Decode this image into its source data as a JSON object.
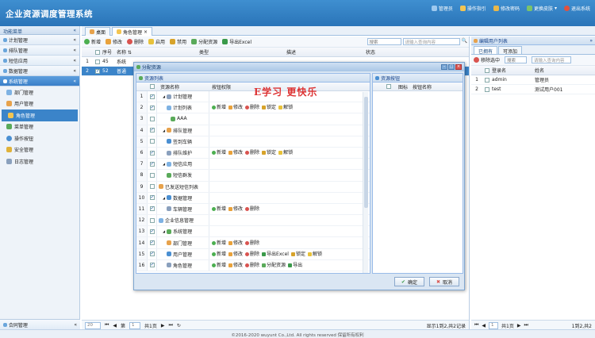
{
  "header": {
    "title": "企业资源调度管理系统",
    "links": [
      "管理员",
      "操作指引",
      "修改密码",
      "更换皮肤",
      "退出系统"
    ]
  },
  "sidebar": {
    "title": "功能菜单",
    "collapse": "«",
    "groups": [
      "计划管理",
      "排队管理",
      "短信应用",
      "数据管理",
      "系统管理"
    ],
    "items": [
      "部门管理",
      "用户管理",
      "角色管理",
      "菜单管理",
      "操作按钮",
      "安全管理",
      "日志管理"
    ],
    "footer": "合同管理"
  },
  "tabs": [
    "桌面",
    "角色管理"
  ],
  "toolbar": {
    "buttons": [
      "新增",
      "修改",
      "删除",
      "启用",
      "禁用",
      "分配资源",
      "导出Excel"
    ],
    "search_select": "搜索",
    "search_placeholder": "请输入查询内容"
  },
  "grid": {
    "columns": [
      "序号",
      "名称",
      "类型",
      "描述",
      "状态"
    ],
    "rows": [
      {
        "no": "1",
        "id": "45",
        "name": "系统"
      },
      {
        "no": "2",
        "id": "52",
        "name": "普通"
      }
    ]
  },
  "pager": {
    "page_size": "20",
    "page_label": "第",
    "page": "1",
    "total_pages": "共1页",
    "info": "显示1到2,共2记录"
  },
  "right": {
    "title": "编辑用户列表",
    "tabs": [
      "已拥有",
      "可添加"
    ],
    "remove": "移除选中",
    "search_select": "搜索",
    "search_placeholder": "请输入查询内容",
    "columns": [
      "登录名",
      "姓名"
    ],
    "rows": [
      {
        "no": "1",
        "login": "admin",
        "name": "管理员"
      },
      {
        "no": "2",
        "login": "test",
        "name": "测试用户001"
      }
    ],
    "pager_page": "1",
    "pager_total": "共1页",
    "pager_info": "1到2,共2"
  },
  "dialog": {
    "title": "分配资源",
    "watermark": "E学习  更快乐",
    "left_title": "资源列表",
    "left_cols": [
      "资源名称",
      "按钮权限"
    ],
    "right_title": "资源按钮",
    "right_cols": [
      "图标",
      "按钮名称"
    ],
    "ok": "确定",
    "cancel": "取消",
    "rows": [
      {
        "no": "1",
        "name": "计划管理",
        "indent": 1,
        "perms": []
      },
      {
        "no": "2",
        "name": "计划列表",
        "indent": 2,
        "perms": [
          "新增",
          "修改",
          "删除",
          "锁定",
          "解锁"
        ]
      },
      {
        "no": "3",
        "name": "AAA",
        "indent": 3,
        "perms": []
      },
      {
        "no": "4",
        "name": "排队管理",
        "indent": 1,
        "perms": []
      },
      {
        "no": "5",
        "name": "签到车辆",
        "indent": 2,
        "perms": []
      },
      {
        "no": "6",
        "name": "排队维护",
        "indent": 2,
        "perms": [
          "新增",
          "修改",
          "删除",
          "锁定",
          "解锁"
        ]
      },
      {
        "no": "7",
        "name": "短信应用",
        "indent": 1,
        "perms": []
      },
      {
        "no": "8",
        "name": "短信群发",
        "indent": 2,
        "perms": []
      },
      {
        "no": "9",
        "name": "已发送短信列表",
        "indent": 0,
        "perms": []
      },
      {
        "no": "10",
        "name": "数据管理",
        "indent": 1,
        "perms": []
      },
      {
        "no": "11",
        "name": "车辆管理",
        "indent": 2,
        "perms": [
          "新增",
          "修改",
          "删除"
        ]
      },
      {
        "no": "12",
        "name": "企业信息管理",
        "indent": 0,
        "perms": []
      },
      {
        "no": "13",
        "name": "系统管理",
        "indent": 1,
        "perms": []
      },
      {
        "no": "14",
        "name": "部门管理",
        "indent": 2,
        "perms": [
          "新增",
          "修改",
          "删除"
        ]
      },
      {
        "no": "15",
        "name": "用户管理",
        "indent": 2,
        "perms": [
          "新增",
          "修改",
          "删除",
          "导出Excel",
          "锁定",
          "解锁"
        ]
      },
      {
        "no": "16",
        "name": "角色管理",
        "indent": 2,
        "perms": [
          "新增",
          "修改",
          "删除",
          "分配资源",
          "导出"
        ]
      }
    ]
  },
  "footer": "©2016-2020 wuyunt Co.,Ltd. All rights reserved 保留所有权利"
}
